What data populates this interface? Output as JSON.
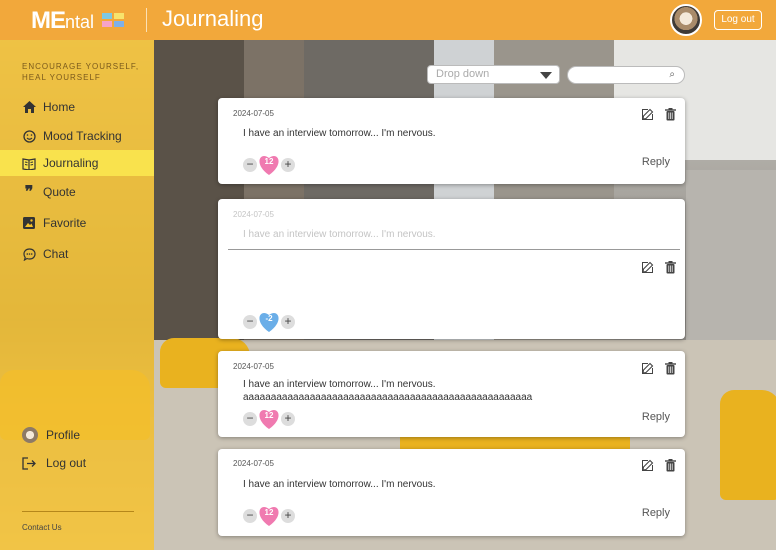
{
  "app": {
    "logo_bold": "ME",
    "logo_rest": "ntal",
    "page_title": "Journaling",
    "logout_button": "Log out"
  },
  "brand_colors": {
    "header": "#f2a83b",
    "sidebar": "#f6c129",
    "active_item": "#f9e24d",
    "heart_pink": "#f07ab0",
    "heart_blue": "#6aaee8"
  },
  "sidebar": {
    "tagline": "ENCOURAGE YOURSELF, HEAL YOURSELF",
    "items": [
      {
        "label": "Home",
        "icon": "home-icon"
      },
      {
        "label": "Mood Tracking",
        "icon": "smiley-icon"
      },
      {
        "label": "Journaling",
        "icon": "journal-icon",
        "active": true
      },
      {
        "label": "Quote",
        "icon": "quote-icon"
      },
      {
        "label": "Favorite",
        "icon": "image-icon"
      },
      {
        "label": "Chat",
        "icon": "chat-icon"
      }
    ],
    "bottom": [
      {
        "label": "Profile",
        "icon": "avatar-icon"
      },
      {
        "label": "Log out",
        "icon": "logout-icon"
      }
    ],
    "contact": "Contact Us"
  },
  "filter": {
    "dropdown_placeholder": "Drop down",
    "search_value": ""
  },
  "entries": [
    {
      "date": "2024-07-05",
      "text": "I have an interview tomorrow... I'm nervous.",
      "extra": "",
      "likes": "12",
      "heart": "pink",
      "reply": "Reply"
    },
    {
      "date": "2024-07-05",
      "text": "I have an interview tomorrow... I'm nervous.",
      "extra": "",
      "likes": "-2",
      "heart": "blue",
      "reply": ""
    },
    {
      "date": "2024-07-05",
      "text": "I have an interview tomorrow... I'm nervous.",
      "extra": "aaaaaaaaaaaaaaaaaaaaaaaaaaaaaaaaaaaaaaaaaaaaaaaaaaaa",
      "likes": "12",
      "heart": "pink",
      "reply": "Reply"
    },
    {
      "date": "2024-07-05",
      "text": "I have an interview tomorrow... I'm nervous.",
      "extra": "",
      "likes": "12",
      "heart": "pink",
      "reply": "Reply"
    }
  ]
}
